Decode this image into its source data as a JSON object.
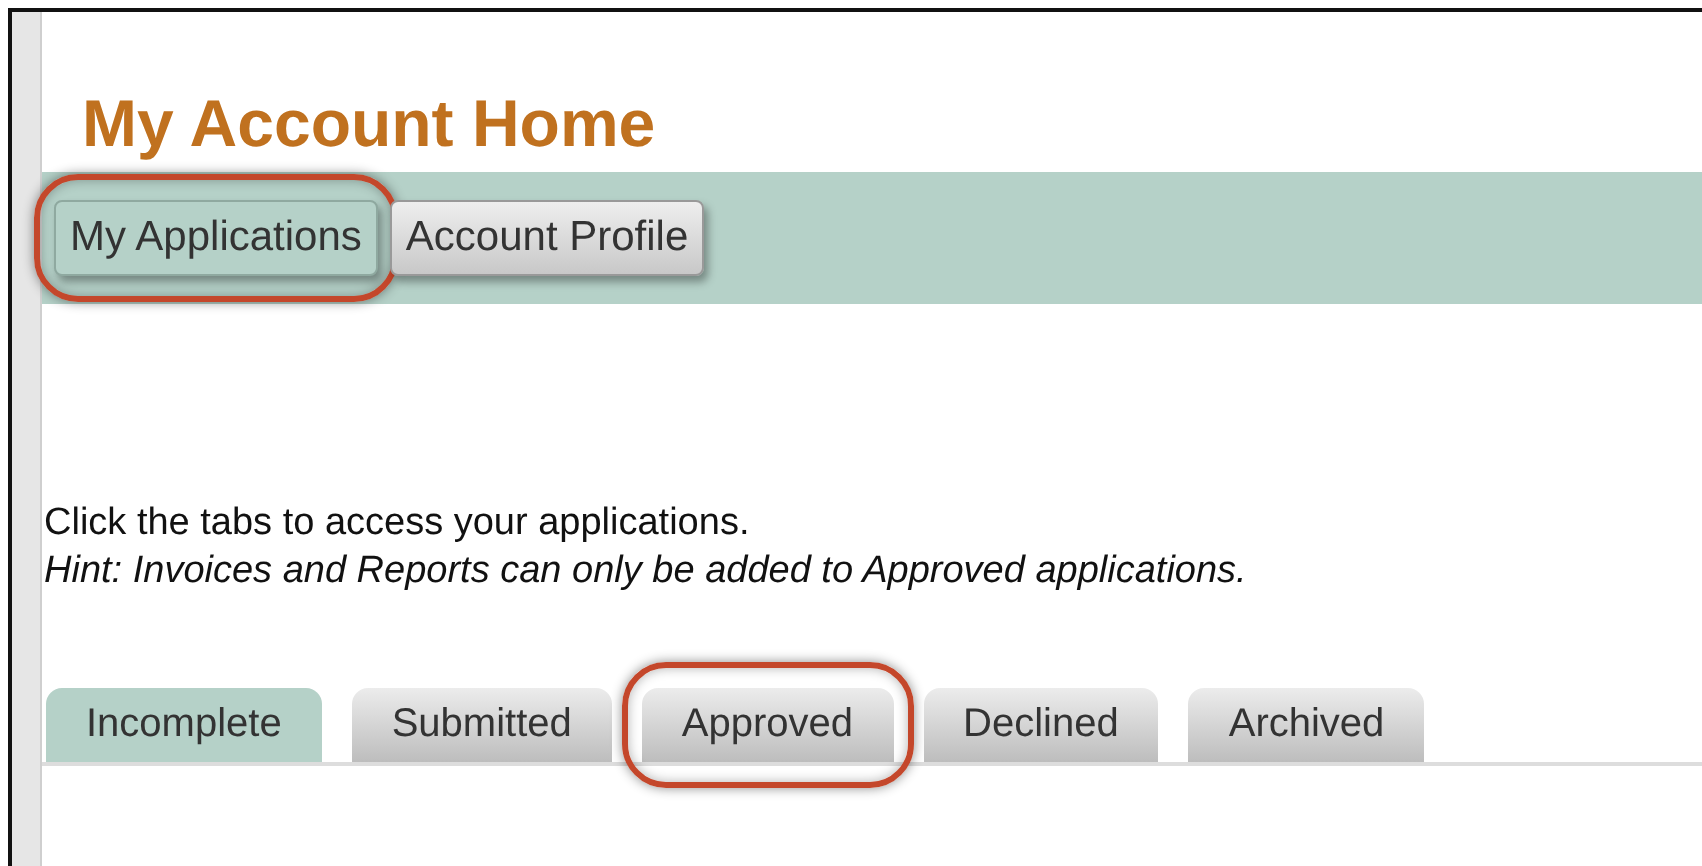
{
  "title": "My Account Home",
  "nav_buttons": [
    {
      "label": "My Applications",
      "selected": true,
      "highlighted": true
    },
    {
      "label": "Account Profile",
      "selected": false,
      "highlighted": false
    }
  ],
  "instructions": "Click the tabs to access your applications.",
  "hint": "Hint: Invoices and Reports can only be added to Approved applications.",
  "tabs": [
    {
      "label": "Incomplete",
      "selected": true,
      "highlighted": false
    },
    {
      "label": "Submitted",
      "selected": false,
      "highlighted": false
    },
    {
      "label": "Approved",
      "selected": false,
      "highlighted": true
    },
    {
      "label": "Declined",
      "selected": false,
      "highlighted": false
    },
    {
      "label": "Archived",
      "selected": false,
      "highlighted": false
    }
  ]
}
